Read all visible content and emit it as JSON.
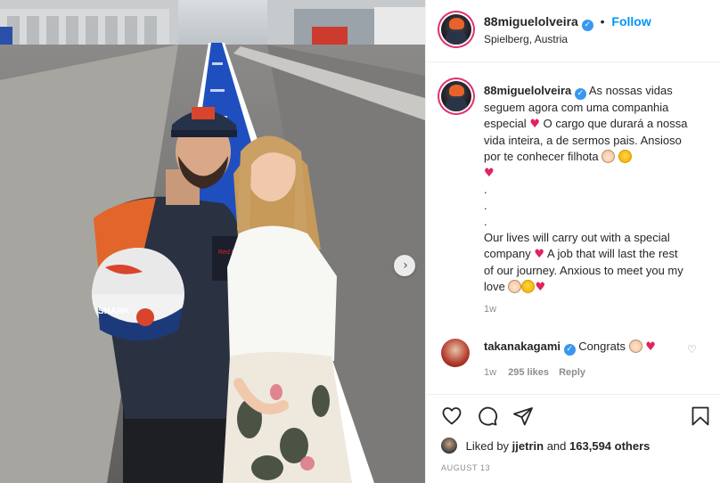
{
  "post": {
    "author": "88miguelolveira",
    "follow_label": "Follow",
    "dot": "•",
    "location": "Spielberg, Austria",
    "verified_mark": "✓"
  },
  "caption": {
    "username": "88miguelolveira",
    "pt_1": "As nossas vidas seguem agora com uma companhia especial",
    "pt_2": "O cargo que durará a nossa vida inteira, a de sermos pais. Ansioso por te conhecer filhota",
    "dots": ".\n.\n.",
    "en_1": "Our lives will carry out with a special company",
    "en_2": "A job that will last the rest of our journey. Anxious to meet you my love",
    "time": "1w",
    "heart": "♥",
    "emojis": [
      "baby-face-emoji",
      "smiling-face-emoji",
      "heart-emoji"
    ]
  },
  "comment": {
    "username": "takanakagami",
    "text": "Congrats",
    "time": "1w",
    "likes": "295 likes",
    "reply_label": "Reply",
    "like_glyph": "♡"
  },
  "footer": {
    "liked_by_prefix": "Liked by",
    "liked_by_user": "jjetrin",
    "liked_by_and": "and",
    "likes_count": "163,594 others",
    "date": "AUGUST 13"
  },
  "photo": {
    "next_glyph": "›"
  },
  "colors": {
    "link_blue": "#0095f6",
    "verified_blue": "#3897f0",
    "heart_red": "#e0245e",
    "muted": "#8e8e8e",
    "pit_lane_blue": "#1f4fbf"
  }
}
